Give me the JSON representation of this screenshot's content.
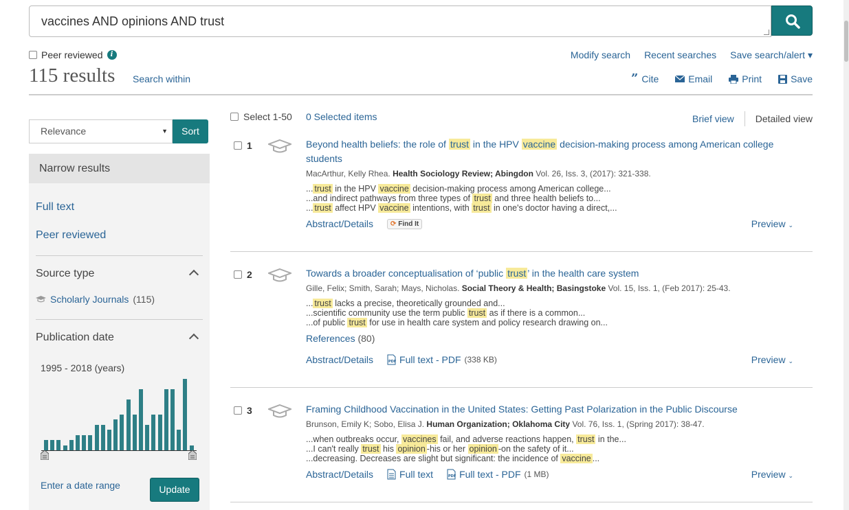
{
  "search": {
    "query": "vaccines AND opinions AND trust"
  },
  "peer_reviewed_label": "Peer reviewed",
  "results_count": "115 results",
  "search_within": "Search within",
  "top_links": {
    "modify": "Modify search",
    "recent": "Recent searches",
    "save": "Save search/alert ▾"
  },
  "tools": {
    "cite": "Cite",
    "email": "Email",
    "print": "Print",
    "save": "Save"
  },
  "sort": {
    "selected": "Relevance",
    "button": "Sort"
  },
  "sidebar": {
    "narrow": "Narrow results",
    "full_text": "Full text",
    "peer_reviewed": "Peer reviewed",
    "source_type": "Source type",
    "source_item": "Scholarly Journals",
    "source_count": "(115)",
    "pub_date": "Publication date",
    "date_range": "1995 - 2018 (years)",
    "histogram_values": [
      4,
      4,
      4,
      2,
      4,
      6,
      6,
      6,
      10,
      10,
      8,
      12,
      14,
      20,
      14,
      24,
      10,
      14,
      14,
      24,
      24,
      8,
      28,
      2
    ],
    "enter_range": "Enter a date range",
    "update": "Update"
  },
  "results_header": {
    "select": "Select 1-50",
    "selected": "0 Selected items",
    "brief": "Brief view",
    "detailed": "Detailed view"
  },
  "results": [
    {
      "num": "1",
      "title_parts": [
        "Beyond health beliefs: the role of ",
        "trust",
        " in the HPV ",
        "vaccine",
        " decision-making process among American college students"
      ],
      "authors": "MacArthur, Kelly Rhea. ",
      "journal": "Health Sociology Review; Abingdon",
      "details": " Vol. 26, Iss. 3,  (2017): 321-338.",
      "abstract": "Abstract/Details",
      "findit": "Find It",
      "preview": "Preview"
    },
    {
      "num": "2",
      "title_parts": [
        "Towards a broader conceptualisation of ‘public ",
        "trust",
        "’ in the health care system"
      ],
      "authors": "Gille, Felix; Smith, Sarah; Mays, Nicholas. ",
      "journal": "Social Theory & Health; Basingstoke",
      "details": " Vol. 15, Iss. 1,  (Feb 2017): 25-43.",
      "references": "References",
      "ref_count": "(80)",
      "abstract": "Abstract/Details",
      "pdf": "Full text - PDF",
      "pdf_size": "(338 KB)",
      "preview": "Preview"
    },
    {
      "num": "3",
      "title": "Framing Childhood Vaccination in the United States: Getting Past Polarization in the Public Discourse",
      "authors": "Brunson, Emily K; Sobo, Elisa J. ",
      "journal": "Human Organization; Oklahoma City",
      "details": " Vol. 76, Iss. 1,  (Spring 2017): 38-47.",
      "abstract": "Abstract/Details",
      "fulltext": "Full text",
      "pdf": "Full text - PDF",
      "pdf_size": "(1 MB)",
      "preview": "Preview"
    }
  ],
  "snippets": {
    "r1": [
      [
        "...",
        "trust",
        " in the HPV ",
        "vaccine",
        " decision-making process among American college..."
      ],
      [
        "...and indirect pathways from three types of ",
        "trust",
        " and three health beliefs to..."
      ],
      [
        "...",
        "trust",
        " affect HPV ",
        "vaccine",
        " intentions, with ",
        "trust",
        " in one's doctor having a direct,..."
      ]
    ],
    "r2": [
      [
        "...",
        "trust",
        " lacks a precise, theoretically grounded and..."
      ],
      [
        "...scientific community use the term public ",
        "trust",
        " as if there is a common..."
      ],
      [
        "...of public ",
        "trust",
        " for use in health care system and policy research drawing on..."
      ]
    ],
    "r3": [
      [
        "...when outbreaks occur, ",
        "vaccines",
        " fail, and adverse reactions happen, ",
        "trust",
        " in the..."
      ],
      [
        "...I can't really ",
        "trust",
        " his ",
        "opinion",
        "-his or her ",
        "opinion",
        "-on the safety of it..."
      ],
      [
        "...decreasing. Decreases are slight but significant: the incidence of ",
        "vaccine",
        "..."
      ]
    ]
  }
}
